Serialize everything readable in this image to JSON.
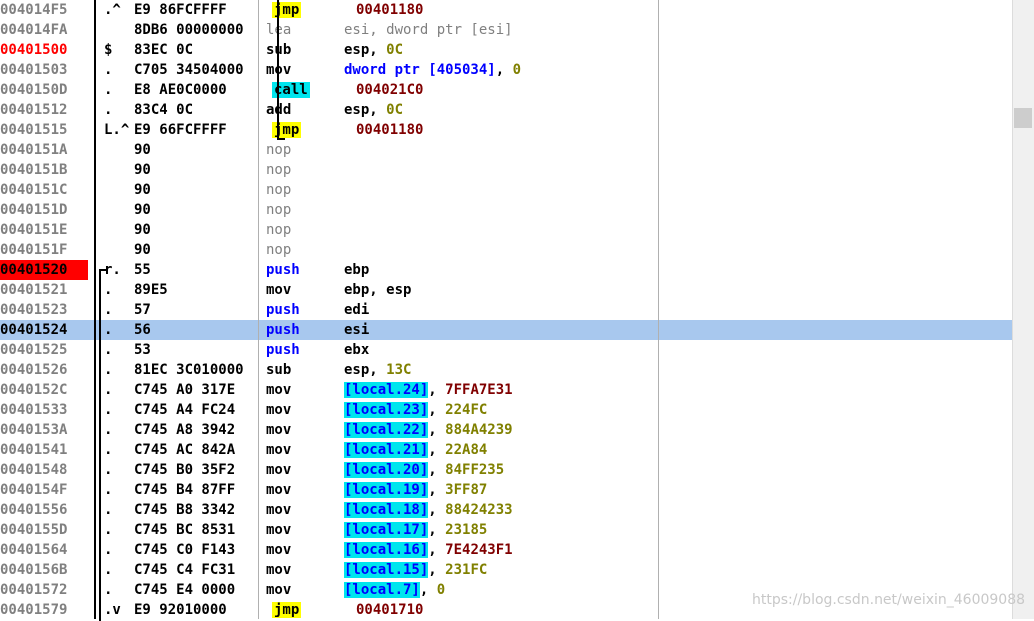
{
  "rows": [
    {
      "addr": "004014F5",
      "flag": ".^",
      "hex": "E9 86FCFFFF",
      "mnem": "jmp",
      "mstyle": "jmp",
      "ops": [
        [
          "00401180",
          "op-addr"
        ]
      ]
    },
    {
      "addr": "004014FA",
      "flag": "",
      "hex": "8DB6 00000000",
      "mnem": "lea",
      "mstyle": "dim",
      "ops": [
        [
          "esi, dword ptr [esi]",
          "dim"
        ]
      ]
    },
    {
      "addr": "00401500",
      "flag": "$",
      "hex": "83EC 0C",
      "mnem": "sub",
      "addrstyle": "entry",
      "ops": [
        [
          "esp, ",
          "punct"
        ],
        [
          "0C",
          "num-olive"
        ]
      ]
    },
    {
      "addr": "00401503",
      "flag": ".",
      "hex": "C705 34504000",
      "mnem": "mov",
      "ops": [
        [
          "dword ptr [405034]",
          "blue"
        ],
        [
          ", ",
          "punct"
        ],
        [
          "0",
          "num-olive"
        ]
      ]
    },
    {
      "addr": "0040150D",
      "flag": ".",
      "hex": "E8 AE0C0000",
      "mnem": "call",
      "mstyle": "call",
      "ops": [
        [
          "004021C0",
          "op-addr"
        ]
      ]
    },
    {
      "addr": "00401512",
      "flag": ".",
      "hex": "83C4 0C",
      "mnem": "add",
      "ops": [
        [
          "esp, ",
          "punct"
        ],
        [
          "0C",
          "num-olive"
        ]
      ]
    },
    {
      "addr": "00401515",
      "flag": "L.^",
      "hex": "E9 66FCFFFF",
      "mnem": "jmp",
      "mstyle": "jmp",
      "ops": [
        [
          "00401180",
          "op-addr"
        ]
      ]
    },
    {
      "addr": "0040151A",
      "flag": "",
      "hex": "90",
      "mnem": "nop",
      "mstyle": "dim",
      "ops": []
    },
    {
      "addr": "0040151B",
      "flag": "",
      "hex": "90",
      "mnem": "nop",
      "mstyle": "dim",
      "ops": []
    },
    {
      "addr": "0040151C",
      "flag": "",
      "hex": "90",
      "mnem": "nop",
      "mstyle": "dim",
      "ops": []
    },
    {
      "addr": "0040151D",
      "flag": "",
      "hex": "90",
      "mnem": "nop",
      "mstyle": "dim",
      "ops": []
    },
    {
      "addr": "0040151E",
      "flag": "",
      "hex": "90",
      "mnem": "nop",
      "mstyle": "dim",
      "ops": []
    },
    {
      "addr": "0040151F",
      "flag": "",
      "hex": "90",
      "mnem": "nop",
      "mstyle": "dim",
      "ops": []
    },
    {
      "addr": "00401520",
      "flag": "r.",
      "hex": "55",
      "mnem": "push",
      "mstyle": "blue",
      "addrstyle": "bp",
      "ops": [
        [
          "ebp",
          "punct"
        ]
      ]
    },
    {
      "addr": "00401521",
      "flag": ".",
      "hex": "89E5",
      "mnem": "mov",
      "ops": [
        [
          "ebp, esp",
          "punct"
        ]
      ]
    },
    {
      "addr": "00401523",
      "flag": ".",
      "hex": "57",
      "mnem": "push",
      "mstyle": "blue",
      "ops": [
        [
          "edi",
          "punct"
        ]
      ]
    },
    {
      "addr": "00401524",
      "flag": ".",
      "hex": "56",
      "mnem": "push",
      "mstyle": "blue",
      "selected": true,
      "ops": [
        [
          "esi",
          "punct"
        ]
      ]
    },
    {
      "addr": "00401525",
      "flag": ".",
      "hex": "53",
      "mnem": "push",
      "mstyle": "blue",
      "ops": [
        [
          "ebx",
          "punct"
        ]
      ]
    },
    {
      "addr": "00401526",
      "flag": ".",
      "hex": "81EC 3C010000",
      "mnem": "sub",
      "ops": [
        [
          "esp, ",
          "punct"
        ],
        [
          "13C",
          "num-olive"
        ]
      ]
    },
    {
      "addr": "0040152C",
      "flag": ".",
      "hex": "C745 A0 317E",
      "mnem": "mov",
      "ops": [
        [
          "[local.24]",
          "lbl"
        ],
        [
          ", ",
          "punct"
        ],
        [
          "7FFA7E31",
          "op-addr"
        ]
      ]
    },
    {
      "addr": "00401533",
      "flag": ".",
      "hex": "C745 A4 FC24",
      "mnem": "mov",
      "ops": [
        [
          "[local.23]",
          "lbl"
        ],
        [
          ", ",
          "punct"
        ],
        [
          "224FC",
          "num-olive"
        ]
      ]
    },
    {
      "addr": "0040153A",
      "flag": ".",
      "hex": "C745 A8 3942",
      "mnem": "mov",
      "ops": [
        [
          "[local.22]",
          "lbl"
        ],
        [
          ", ",
          "punct"
        ],
        [
          "884A4239",
          "num-olive"
        ]
      ]
    },
    {
      "addr": "00401541",
      "flag": ".",
      "hex": "C745 AC 842A",
      "mnem": "mov",
      "ops": [
        [
          "[local.21]",
          "lbl"
        ],
        [
          ", ",
          "punct"
        ],
        [
          "22A84",
          "num-olive"
        ]
      ]
    },
    {
      "addr": "00401548",
      "flag": ".",
      "hex": "C745 B0 35F2",
      "mnem": "mov",
      "ops": [
        [
          "[local.20]",
          "lbl"
        ],
        [
          ", ",
          "punct"
        ],
        [
          "84FF235",
          "num-olive"
        ]
      ]
    },
    {
      "addr": "0040154F",
      "flag": ".",
      "hex": "C745 B4 87FF",
      "mnem": "mov",
      "ops": [
        [
          "[local.19]",
          "lbl"
        ],
        [
          ", ",
          "punct"
        ],
        [
          "3FF87",
          "num-olive"
        ]
      ]
    },
    {
      "addr": "00401556",
      "flag": ".",
      "hex": "C745 B8 3342",
      "mnem": "mov",
      "ops": [
        [
          "[local.18]",
          "lbl"
        ],
        [
          ", ",
          "punct"
        ],
        [
          "88424233",
          "num-olive"
        ]
      ]
    },
    {
      "addr": "0040155D",
      "flag": ".",
      "hex": "C745 BC 8531",
      "mnem": "mov",
      "ops": [
        [
          "[local.17]",
          "lbl"
        ],
        [
          ", ",
          "punct"
        ],
        [
          "23185",
          "num-olive"
        ]
      ]
    },
    {
      "addr": "00401564",
      "flag": ".",
      "hex": "C745 C0 F143",
      "mnem": "mov",
      "ops": [
        [
          "[local.16]",
          "lbl"
        ],
        [
          ", ",
          "punct"
        ],
        [
          "7E4243F1",
          "op-addr"
        ]
      ]
    },
    {
      "addr": "0040156B",
      "flag": ".",
      "hex": "C745 C4 FC31",
      "mnem": "mov",
      "ops": [
        [
          "[local.15]",
          "lbl"
        ],
        [
          ", ",
          "punct"
        ],
        [
          "231FC",
          "num-olive"
        ]
      ]
    },
    {
      "addr": "00401572",
      "flag": ".",
      "hex": "C745 E4 0000",
      "mnem": "mov",
      "ops": [
        [
          "[local.7]",
          "lbl"
        ],
        [
          ", ",
          "punct"
        ],
        [
          "0",
          "num-olive"
        ]
      ]
    },
    {
      "addr": "00401579",
      "flag": ".v",
      "hex": "E9 92010000",
      "mnem": "jmp",
      "mstyle": "jmp",
      "ops": [
        [
          "00401710",
          "op-addr"
        ]
      ]
    }
  ],
  "watermark": "https://blog.csdn.net/weixin_46009088",
  "colors": {
    "breakpoint": "#ff0000",
    "selection": "#a8c8ee",
    "jmp_highlight": "#ffff00",
    "call_highlight": "#00e5ee",
    "label_highlight": "#00e5ee"
  }
}
